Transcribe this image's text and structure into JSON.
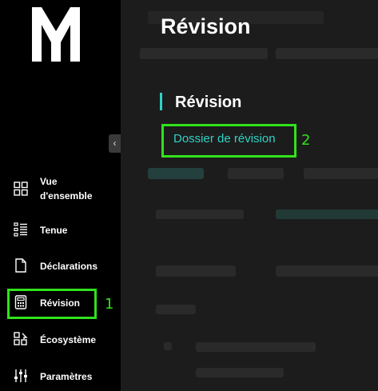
{
  "sidebar": {
    "logo_text": "M",
    "collapse_icon": "chevron-left-icon",
    "items": [
      {
        "label_line1": "Vue",
        "label_line2": "d'ensemble",
        "icon": "grid-icon"
      },
      {
        "label": "Tenue",
        "icon": "list-icon"
      },
      {
        "label": "Déclarations",
        "icon": "document-icon"
      },
      {
        "label": "Révision",
        "icon": "calculator-icon"
      },
      {
        "label": "Écosystème",
        "icon": "puzzle-icon"
      },
      {
        "label": "Paramètres",
        "icon": "sliders-icon"
      }
    ]
  },
  "main": {
    "page_title": "Révision",
    "popup": {
      "title": "Révision",
      "link": "Dossier de révision"
    }
  },
  "annotations": {
    "marker_1": "1",
    "marker_2": "2",
    "highlight_color": "#31e21b"
  },
  "colors": {
    "accent": "#2fd3c6",
    "sidebar_bg": "#000000",
    "main_bg": "#1c1c1c"
  }
}
